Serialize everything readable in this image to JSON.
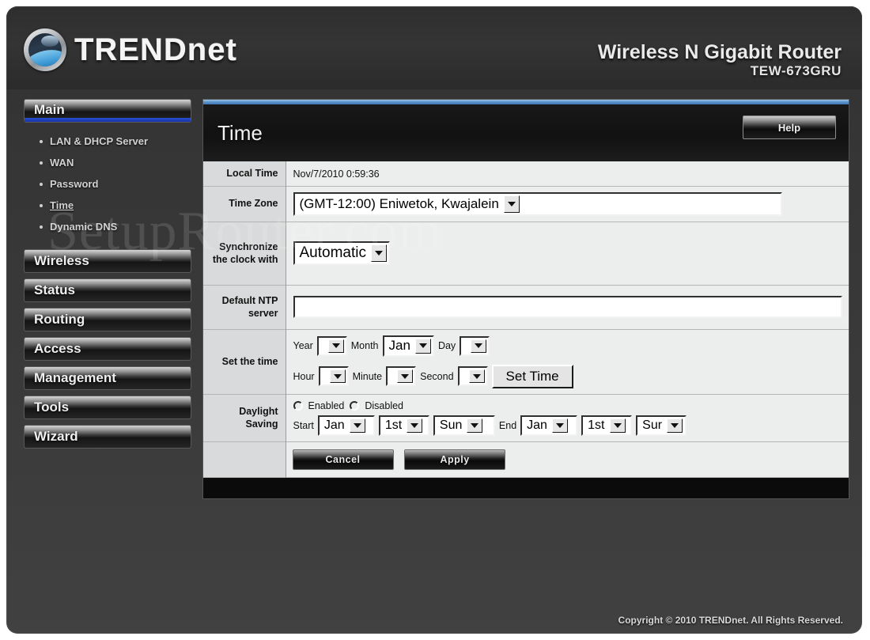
{
  "header": {
    "brand_upper": "TREND",
    "brand_lower": "net",
    "product_line1": "Wireless N Gigabit Router",
    "product_line2": "TEW-673GRU"
  },
  "watermark": "SetupRouter.com",
  "sidebar": {
    "groups": [
      {
        "label": "Main",
        "active": true,
        "items": [
          {
            "label": "LAN & DHCP Server",
            "current": false
          },
          {
            "label": "WAN",
            "current": false
          },
          {
            "label": "Password",
            "current": false
          },
          {
            "label": "Time",
            "current": true
          },
          {
            "label": "Dynamic DNS",
            "current": false
          }
        ]
      },
      {
        "label": "Wireless",
        "active": false,
        "items": []
      },
      {
        "label": "Status",
        "active": false,
        "items": []
      },
      {
        "label": "Routing",
        "active": false,
        "items": []
      },
      {
        "label": "Access",
        "active": false,
        "items": []
      },
      {
        "label": "Management",
        "active": false,
        "items": []
      },
      {
        "label": "Tools",
        "active": false,
        "items": []
      },
      {
        "label": "Wizard",
        "active": false,
        "items": []
      }
    ]
  },
  "panel": {
    "title": "Time",
    "help_label": "Help"
  },
  "form": {
    "local_time": {
      "label": "Local Time",
      "value": "Nov/7/2010 0:59:36"
    },
    "time_zone": {
      "label": "Time Zone",
      "value": "(GMT-12:00) Eniwetok, Kwajalein"
    },
    "sync_clock": {
      "label": "Synchronize the clock with",
      "value": "Automatic"
    },
    "ntp_server": {
      "label": "Default NTP server",
      "value": "",
      "placeholder": ""
    },
    "set_time": {
      "label": "Set the time",
      "year_label": "Year",
      "year_value": "",
      "month_label": "Month",
      "month_value": "Jan",
      "day_label": "Day",
      "day_value": "",
      "hour_label": "Hour",
      "hour_value": "",
      "minute_label": "Minute",
      "minute_value": "",
      "second_label": "Second",
      "second_value": "",
      "button_label": "Set Time"
    },
    "daylight_saving": {
      "label": "Daylight Saving",
      "enabled_label": "Enabled",
      "disabled_label": "Disabled",
      "enabled_selected": false,
      "disabled_selected": false,
      "start_label": "Start",
      "start_month": "Jan",
      "start_week": "1st",
      "start_day": "Sun",
      "end_label": "End",
      "end_month": "Jan",
      "end_week": "1st",
      "end_day": "Sur"
    },
    "actions": {
      "cancel_label": "Cancel",
      "apply_label": "Apply"
    }
  },
  "footer": {
    "copyright": "Copyright © 2010 TRENDnet. All Rights Reserved."
  },
  "colors": {
    "accent_blue": "#1433a8",
    "panel_bg": "#eceded",
    "label_bg": "#d9dadb",
    "shell_bg": "#3a3a3a"
  }
}
